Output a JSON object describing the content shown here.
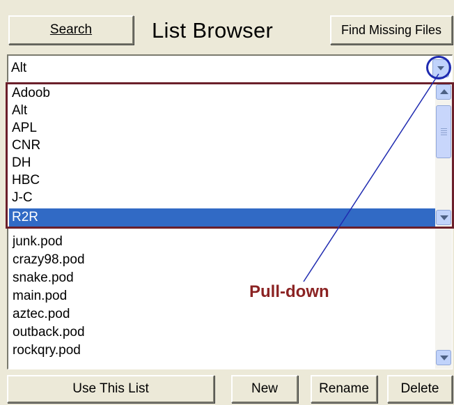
{
  "window": {
    "title": "List Browser"
  },
  "buttons": {
    "search": "Search",
    "find_missing": "Find Missing Files",
    "use_list": "Use This List",
    "new": "New",
    "rename": "Rename",
    "delete": "Delete"
  },
  "combo": {
    "value": "Alt"
  },
  "dropdown": {
    "items": [
      "Adoob",
      "Alt",
      "APL",
      "CNR",
      "DH",
      "HBC",
      "J-C",
      "R2R"
    ],
    "selected": "R2R"
  },
  "files": [
    "junk.pod",
    "crazy98.pod",
    "snake.pod",
    "main.pod",
    "aztec.pod",
    "outback.pod",
    "rockqry.pod"
  ],
  "annotation": {
    "label": "Pull-down"
  },
  "colors": {
    "selection": "#316ac5",
    "annotation_box": "#6b1f2a",
    "annotation_circle": "#1f2bb0",
    "annotation_text": "#8b2323"
  }
}
